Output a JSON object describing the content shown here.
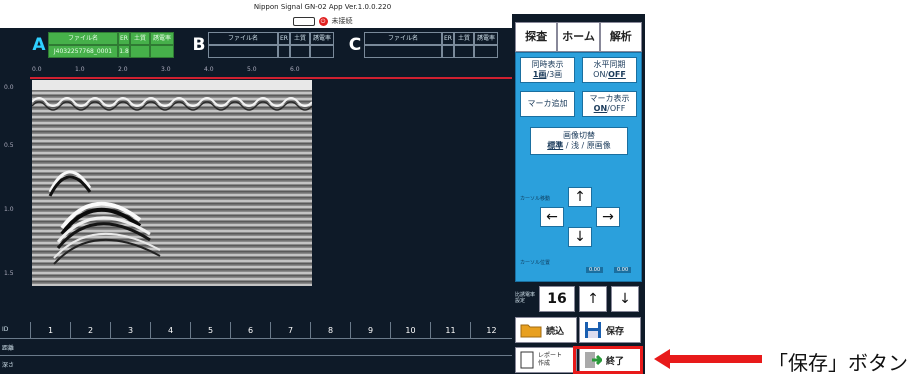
{
  "app": {
    "title": "Nippon Signal GN-02 App Ver.1.0.0.220",
    "status": "未接続"
  },
  "channels": [
    {
      "letter": "A",
      "headers": [
        "ファイル名",
        "ER",
        "土質",
        "誘電率"
      ],
      "values": [
        "J4032257768_0001",
        "1.8",
        "",
        ""
      ]
    },
    {
      "letter": "B",
      "headers": [
        "ファイル名",
        "ER",
        "土質",
        "誘電率"
      ]
    },
    {
      "letter": "C",
      "headers": [
        "ファイル名",
        "ER",
        "土質",
        "誘電率"
      ]
    }
  ],
  "ruler": {
    "x_ticks": [
      "0.0",
      "1.0",
      "2.0",
      "3.0",
      "4.0",
      "5.0",
      "6.0"
    ],
    "y_ticks": [
      "0.0",
      "0.5",
      "1.0",
      "1.5"
    ]
  },
  "table": {
    "row_labels": [
      "ID",
      "距離",
      "深さ"
    ],
    "ids": [
      "1",
      "2",
      "3",
      "4",
      "5",
      "6",
      "7",
      "8",
      "9",
      "10",
      "11",
      "12"
    ]
  },
  "panel": {
    "tabs": [
      "探査",
      "ホーム",
      "解析"
    ],
    "sim_display": {
      "line1": "同時表示",
      "opt1": "1画",
      "sep": "/",
      "opt2": "3画"
    },
    "h_sync": {
      "line1": "水平同期",
      "on": "ON",
      "sep": "/",
      "off": "OFF"
    },
    "add_marker": "マーカ追加",
    "marker_disp": {
      "line1": "マーカ表示",
      "on": "ON",
      "sep": "/",
      "off": "OFF"
    },
    "img_switch": {
      "line1": "画像切替",
      "opt1": "標準",
      "opt2": "浅",
      "opt3": "原画像"
    },
    "cursor_label": "カーソル移動",
    "arrows": [
      "↑",
      "←",
      "→",
      "↓"
    ],
    "pos_label": "カーソル位置",
    "pos_values": [
      "0.00",
      "0.00"
    ],
    "speed_label": "比誘電率設定",
    "speed_value": "16",
    "speed_up": "↑",
    "speed_down": "↓",
    "load": "読込",
    "save": "保存",
    "report_l1": "レポート",
    "report_l2": "作成",
    "exit": "終了"
  },
  "callout": {
    "text": "「保存」ボタン",
    "color": "#e81a1a"
  }
}
